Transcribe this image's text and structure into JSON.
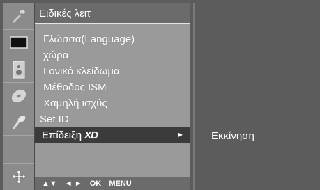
{
  "menu": {
    "title": "Ειδικές λειτ",
    "items": [
      {
        "label": "Γλώσσα(Language)"
      },
      {
        "label": "χώρα"
      },
      {
        "label": "Γονικό κλείδωμα"
      },
      {
        "label": "Μέθοδος ISM"
      },
      {
        "label": "Χαμηλή ισχύς"
      },
      {
        "label": "Set ID"
      },
      {
        "label": "Επίδειξη",
        "suffix": "XD",
        "arrow": "►"
      }
    ],
    "selected_index": 6
  },
  "nav": {
    "updown": "▲▼",
    "leftright": "◄ ►",
    "ok": "OK",
    "menu": "MENU"
  },
  "submenu": {
    "item": "Εκκίνηση"
  },
  "icons": [
    "tools-icon",
    "screen-icon",
    "speaker-icon",
    "disc-icon",
    "satellite-dish-icon",
    "move-arrows-icon"
  ]
}
